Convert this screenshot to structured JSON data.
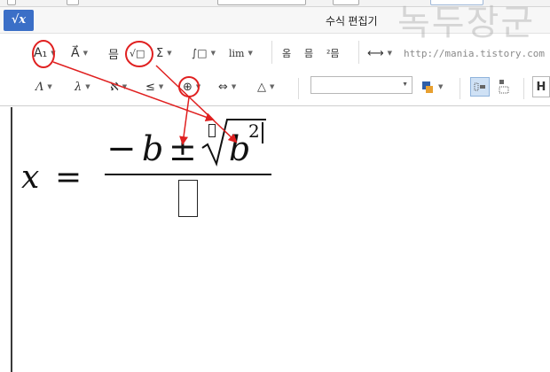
{
  "window": {
    "title": "수식 편집기",
    "app_icon_text": "√x"
  },
  "watermark": {
    "text": "녹두장군",
    "url": "http://mania.tistory.com"
  },
  "toolbar_row1": {
    "items": [
      {
        "name": "style-button",
        "label": "A₁"
      },
      {
        "name": "decoration-button",
        "label": "A⃗"
      },
      {
        "name": "matrix-button",
        "label": "믐"
      },
      {
        "name": "root-button",
        "label": "√□"
      },
      {
        "name": "sum-button",
        "label": "Σ"
      },
      {
        "name": "integral-button",
        "label": "∫□"
      },
      {
        "name": "limit-button",
        "label": "lim"
      }
    ],
    "align_items": [
      "옴",
      "믐",
      "²믐"
    ],
    "right_items": [
      "⟷"
    ]
  },
  "toolbar_row2": {
    "items": [
      {
        "name": "greek-upper-button",
        "label": "Λ"
      },
      {
        "name": "greek-lower-button",
        "label": "λ"
      },
      {
        "name": "symbol-button",
        "label": "ℵ"
      },
      {
        "name": "relation-button",
        "label": "≤"
      },
      {
        "name": "operator-button",
        "label": "⊕"
      },
      {
        "name": "arrow-button",
        "label": "⇔"
      },
      {
        "name": "misc-button",
        "label": "△"
      }
    ],
    "right_label": "H"
  },
  "equation": {
    "lhs": "x",
    "equals": "=",
    "minus": "−",
    "b": "b",
    "plusminus": "±",
    "radical": "√",
    "b2": "b",
    "exponent": "2"
  },
  "annotation_color": "#e02020"
}
